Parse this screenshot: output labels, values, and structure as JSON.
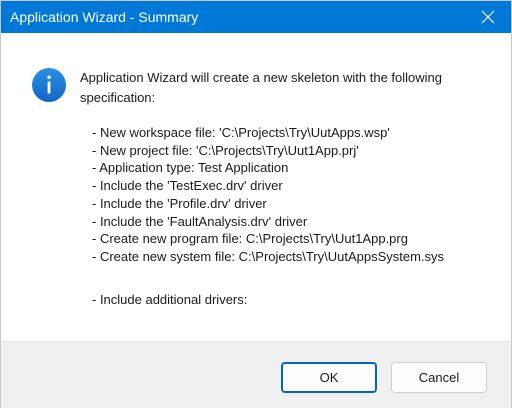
{
  "window": {
    "title": "Application Wizard - Summary"
  },
  "icons": {
    "info": "info-icon",
    "close": "close-icon"
  },
  "colors": {
    "titlebar": "#0078d7",
    "info_icon": "#1a7fd8",
    "ok_border": "#0067c0",
    "footer": "#f0f0f0"
  },
  "message": {
    "intro": "Application Wizard will create a new skeleton with the following specification:",
    "items": [
      "- New workspace file: 'C:\\Projects\\Try\\UutApps.wsp'",
      "- New project file: 'C:\\Projects\\Try\\Uut1App.prj'",
      "- Application type: Test Application",
      "- Include the 'TestExec.drv' driver",
      "- Include the 'Profile.drv' driver",
      "- Include the 'FaultAnalysis.drv' driver",
      "- Create new program file: C:\\Projects\\Try\\Uut1App.prg",
      "- Create new system file: C:\\Projects\\Try\\UutAppsSystem.sys"
    ],
    "additional": "- Include additional drivers:"
  },
  "buttons": {
    "ok": "OK",
    "cancel": "Cancel"
  }
}
